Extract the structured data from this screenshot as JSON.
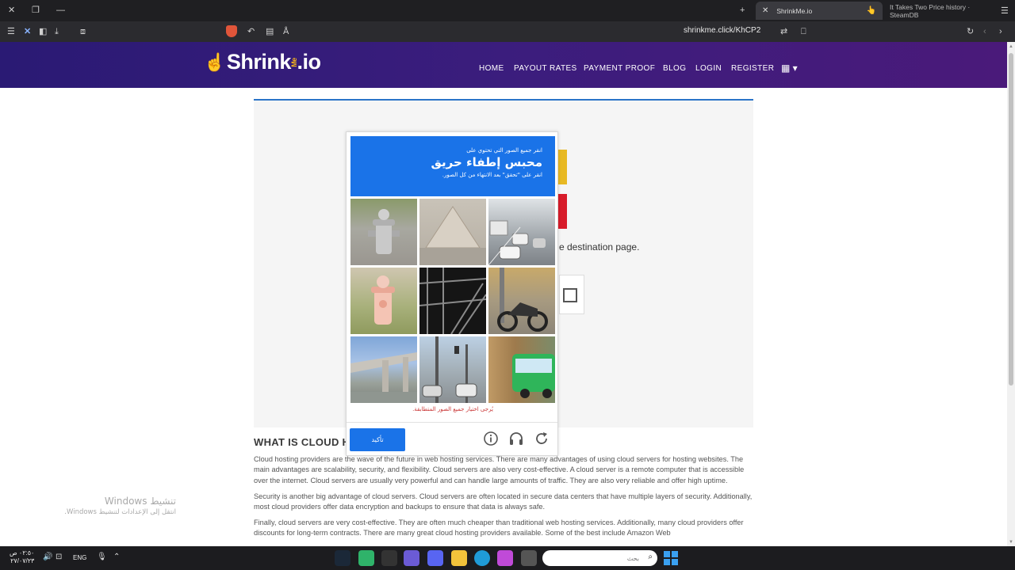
{
  "browser": {
    "tabs": [
      {
        "title": "ShrinkMe.io",
        "active": true
      },
      {
        "title": "It Takes Two Price history · SteamDB",
        "active": false
      }
    ],
    "url": "shrinkme.click/KhCP2",
    "new_tab_symbol": "+"
  },
  "site": {
    "logo_text": "Shrink",
    "logo_me": "Me",
    "logo_suffix": ".io",
    "nav": [
      "HOME",
      "PAYOUT RATES",
      "PAYMENT PROOF",
      "BLOG",
      "LOGIN",
      "REGISTER"
    ]
  },
  "card": {
    "destination_text": "e destination page."
  },
  "captcha": {
    "instruction_small": "انقر جميع الصور التي تحتوي على",
    "target_object": "محبس إطفاء حريق",
    "instruction_sub": "انقر على \"تحقق\" بعد الانتهاء من كل الصور.",
    "error_text": "يُرجى اختيار جميع الصور المتطابقة.",
    "verify_label": "تأكيد",
    "icons": [
      "info-icon",
      "headphones-icon",
      "refresh-icon"
    ]
  },
  "article": {
    "heading": "WHAT IS CLOUD H",
    "paragraphs": [
      "Cloud hosting providers are the wave of the future in web hosting services. There are many advantages of using cloud servers for hosting websites. The main advantages are scalability, security, and flexibility. Cloud servers are also very cost-effective. A cloud server is a remote computer that is accessible over the internet. Cloud servers are usually very powerful and can handle large amounts of traffic. They are also very reliable and offer high uptime.",
      "Security is another big advantage of cloud servers. Cloud servers are often located in secure data centers that have multiple layers of security. Additionally, most cloud providers offer data encryption and backups to ensure that data is always safe.",
      "Finally, cloud servers are very cost-effective. They are often much cheaper than traditional web hosting services. Additionally, many cloud providers offer discounts for long-term contracts. There are many great cloud hosting providers available. Some of the best include Amazon Web"
    ]
  },
  "watermark": {
    "line1": "تنشيط Windows",
    "line2": "انتقل إلى الإعدادات لتنشيط Windows."
  },
  "taskbar": {
    "time": "٠٢:٥٠ ص",
    "date": "٢٧/٠٧/٢٣",
    "lang": "ENG",
    "search_placeholder": "بحث"
  }
}
